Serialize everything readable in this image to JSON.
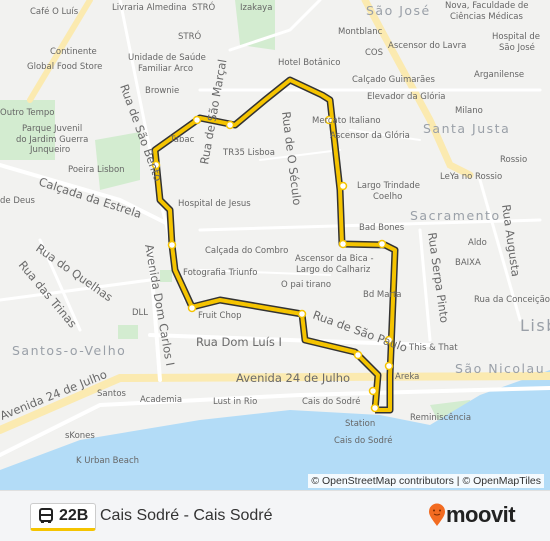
{
  "map": {
    "labels": [
      "Café O Luís",
      "Livraria Almedina",
      "STRÓ",
      "STRÓ",
      "Izakaya",
      "Continente",
      "Global Food Store",
      "Unidade de Saúde",
      "Familiar Arco",
      "Brownie",
      "Outro Tempo",
      "Parque Juvenil",
      "do Jardim Guerra",
      "Junqueiro",
      "Poeira Lisbon",
      "TR35 Lisboa",
      "Hospital de Jesus",
      "Montblanc",
      "COS",
      "Ascensor do Lavra",
      "Hotel Botânico",
      "Calçado Guimarães",
      "Elevador da Glória",
      "Mercato Italiano",
      "Ascensor da Glória",
      "Nova, Faculdade de",
      "Ciências Médicas",
      "Hospital de",
      "São José",
      "Arganilense",
      "Milano",
      "Rossio",
      "LeYa no Rossio",
      "Largo Trindade",
      "Coelho",
      "Bad Bones",
      "Aldo",
      "BAIXA",
      "Calçada do Combro",
      "Fotografia Triunfo",
      "Ascensor da Bica -",
      "Largo do Calhariz",
      "O pai tirano",
      "Bd Marta",
      "Rua da Conceição",
      "DLL",
      "Fruit Chop",
      "This & That",
      "Santos",
      "Academia",
      "Lust in Rio",
      "Cais do Sodré",
      "Station",
      "Cais do Sodré",
      "Reminiscência",
      "sKones",
      "K Urban Beach",
      "Areka",
      "Tabac",
      "de Deus"
    ],
    "streets": [
      "Rua de São Bento",
      "Rua de São Marçal",
      "Rua de O Século",
      "Calçada da Estrela",
      "Rua do Quelhas",
      "Rua das Trinas",
      "Avenida Dom Carlos I",
      "Rua Dom Luís I",
      "Rua de São Paulo",
      "Avenida 24 de Julho",
      "Avenida 24 de Julho",
      "Rua Serpa Pinto",
      "Rua Augusta"
    ],
    "districts": [
      "São José",
      "Santa Justa",
      "Sacramento",
      "Santos-o-Velho",
      "São Nicolau",
      "Lisboa"
    ],
    "attribution": "© OpenStreetMap contributors | © OpenMapTiles",
    "route_color": "#f5c400",
    "water_color": "#b3dcf7"
  },
  "footer": {
    "route_number": "22B",
    "route_name": "Cais Sodré - Cais Sodré",
    "brand": "moovit",
    "bus_icon": "bus-icon",
    "brand_color": "#f26b21"
  }
}
